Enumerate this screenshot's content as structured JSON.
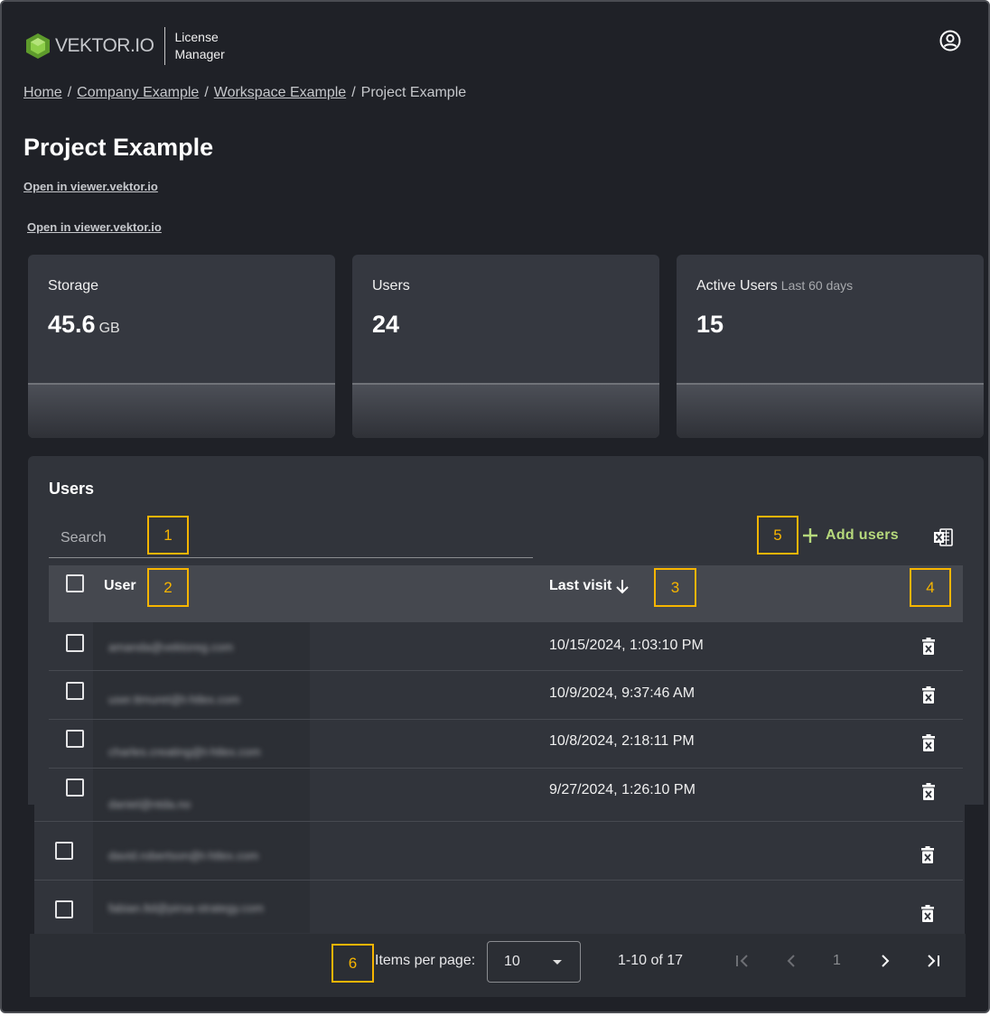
{
  "header": {
    "logo_text": "VEKTOR.IO",
    "app_name_line1": "License",
    "app_name_line2": "Manager"
  },
  "breadcrumb": {
    "items": [
      "Home",
      "Company Example",
      "Workspace Example"
    ],
    "current": "Project Example",
    "separator": "/"
  },
  "page": {
    "title": "Project Example",
    "open_link": "Open in viewer.vektor.io"
  },
  "stats": [
    {
      "label": "Storage",
      "sub": "",
      "value": "45.6",
      "unit": "GB"
    },
    {
      "label": "Users",
      "sub": "",
      "value": "24",
      "unit": ""
    },
    {
      "label": "Active Users",
      "sub": "Last 60 days",
      "value": "15",
      "unit": ""
    }
  ],
  "users": {
    "title": "Users",
    "search_placeholder": "Search",
    "add_label": "Add users",
    "columns": {
      "user": "User",
      "last_visit": "Last visit"
    },
    "rows": [
      {
        "email": "amanda@vektoreg.com",
        "last_visit": "10/15/2024, 1:03:10 PM"
      },
      {
        "email": "user.ttmuret@t-htlex.com",
        "last_visit": "10/9/2024, 9:37:46 AM"
      },
      {
        "email": "charles.creating@t-htlex.com",
        "last_visit": "10/8/2024, 2:18:11 PM"
      },
      {
        "email": "daniel@ntda.no",
        "last_visit": "9/27/2024, 1:26:10 PM"
      },
      {
        "email": "david.robertson@t-htlex.com",
        "last_visit": ""
      },
      {
        "email": "fabian.ltd@pirsa-strategy.com",
        "last_visit": ""
      }
    ]
  },
  "pagination": {
    "items_per_page_label": "Items per page:",
    "items_per_page": "10",
    "range": "1-10 of 17",
    "current_page": "1"
  },
  "annotations": [
    "1",
    "2",
    "3",
    "4",
    "5",
    "6"
  ],
  "colors": {
    "background": "#1f2127",
    "panel": "#31343b",
    "accent": "#b6d97c",
    "annotation": "#f7b500",
    "logo_green": "#78b83c"
  }
}
